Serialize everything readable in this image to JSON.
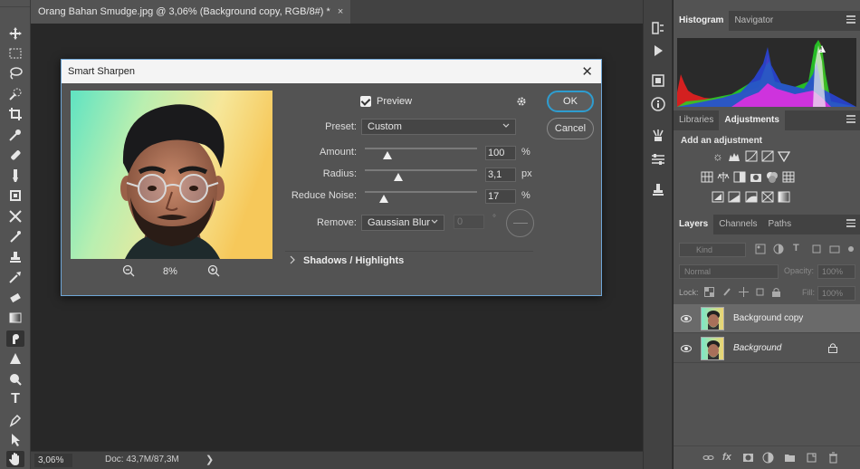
{
  "document": {
    "tab_title": "Orang Bahan Smudge.jpg @ 3,06% (Background copy, RGB/8#) *",
    "tab_close": "×",
    "zoom_status": "3,06%",
    "doc_status": "Doc: 43,7M/87,3M",
    "status_arrow": "❯"
  },
  "toolbar": {
    "tools": [
      "move-tool",
      "marquee-tool",
      "lasso-tool",
      "quick-selection-tool",
      "crop-tool",
      "eyedropper-tool",
      "healing-brush-tool",
      "brush-tool",
      "clone-stamp-tool",
      "history-brush-tool",
      "eraser-tool",
      "gradient-tool",
      "smudge-tool",
      "sharpen-tool",
      "dodge-tool",
      "type-tool",
      "pen-tool",
      "path-selection-tool",
      "hand-tool"
    ],
    "type_glyph": "T",
    "active_tool": "hand-tool"
  },
  "panels": {
    "top_tabs": [
      "Histogram",
      "Navigator"
    ],
    "mid_tabs": [
      "Libraries",
      "Adjustments"
    ],
    "adjustments_title": "Add an adjustment",
    "layer_tabs": [
      "Layers",
      "Channels",
      "Paths"
    ],
    "kind_placeholder": "Kind",
    "blend_mode": "Normal",
    "opacity_label": "Opacity:",
    "opacity_value": "100%",
    "lock_label": "Lock:",
    "fill_label": "Fill:",
    "fill_value": "100%",
    "layers": [
      {
        "name": "Background copy",
        "selected": true,
        "italic": false,
        "locked": false
      },
      {
        "name": "Background",
        "selected": false,
        "italic": true,
        "locked": true
      }
    ]
  },
  "dialog": {
    "title": "Smart Sharpen",
    "close": "✕",
    "preview_label": "Preview",
    "preview_checked": true,
    "zoom_percent": "8%",
    "preset_label": "Preset:",
    "preset_value": "Custom",
    "amount_label": "Amount:",
    "amount_value": "100",
    "amount_unit": "%",
    "amount_fraction": 0.2,
    "radius_label": "Radius:",
    "radius_value": "3,1",
    "radius_unit": "px",
    "radius_fraction": 0.3,
    "noise_label": "Reduce Noise:",
    "noise_value": "17",
    "noise_unit": "%",
    "noise_fraction": 0.17,
    "remove_label": "Remove:",
    "remove_value": "Gaussian Blur",
    "angle_value": "0",
    "angle_unit": "°",
    "section_label": "Shadows / Highlights",
    "ok_label": "OK",
    "cancel_label": "Cancel"
  },
  "colors": {
    "accent": "#2e9dd0",
    "dialog_bg": "#535353",
    "panel_bg": "#535353"
  }
}
